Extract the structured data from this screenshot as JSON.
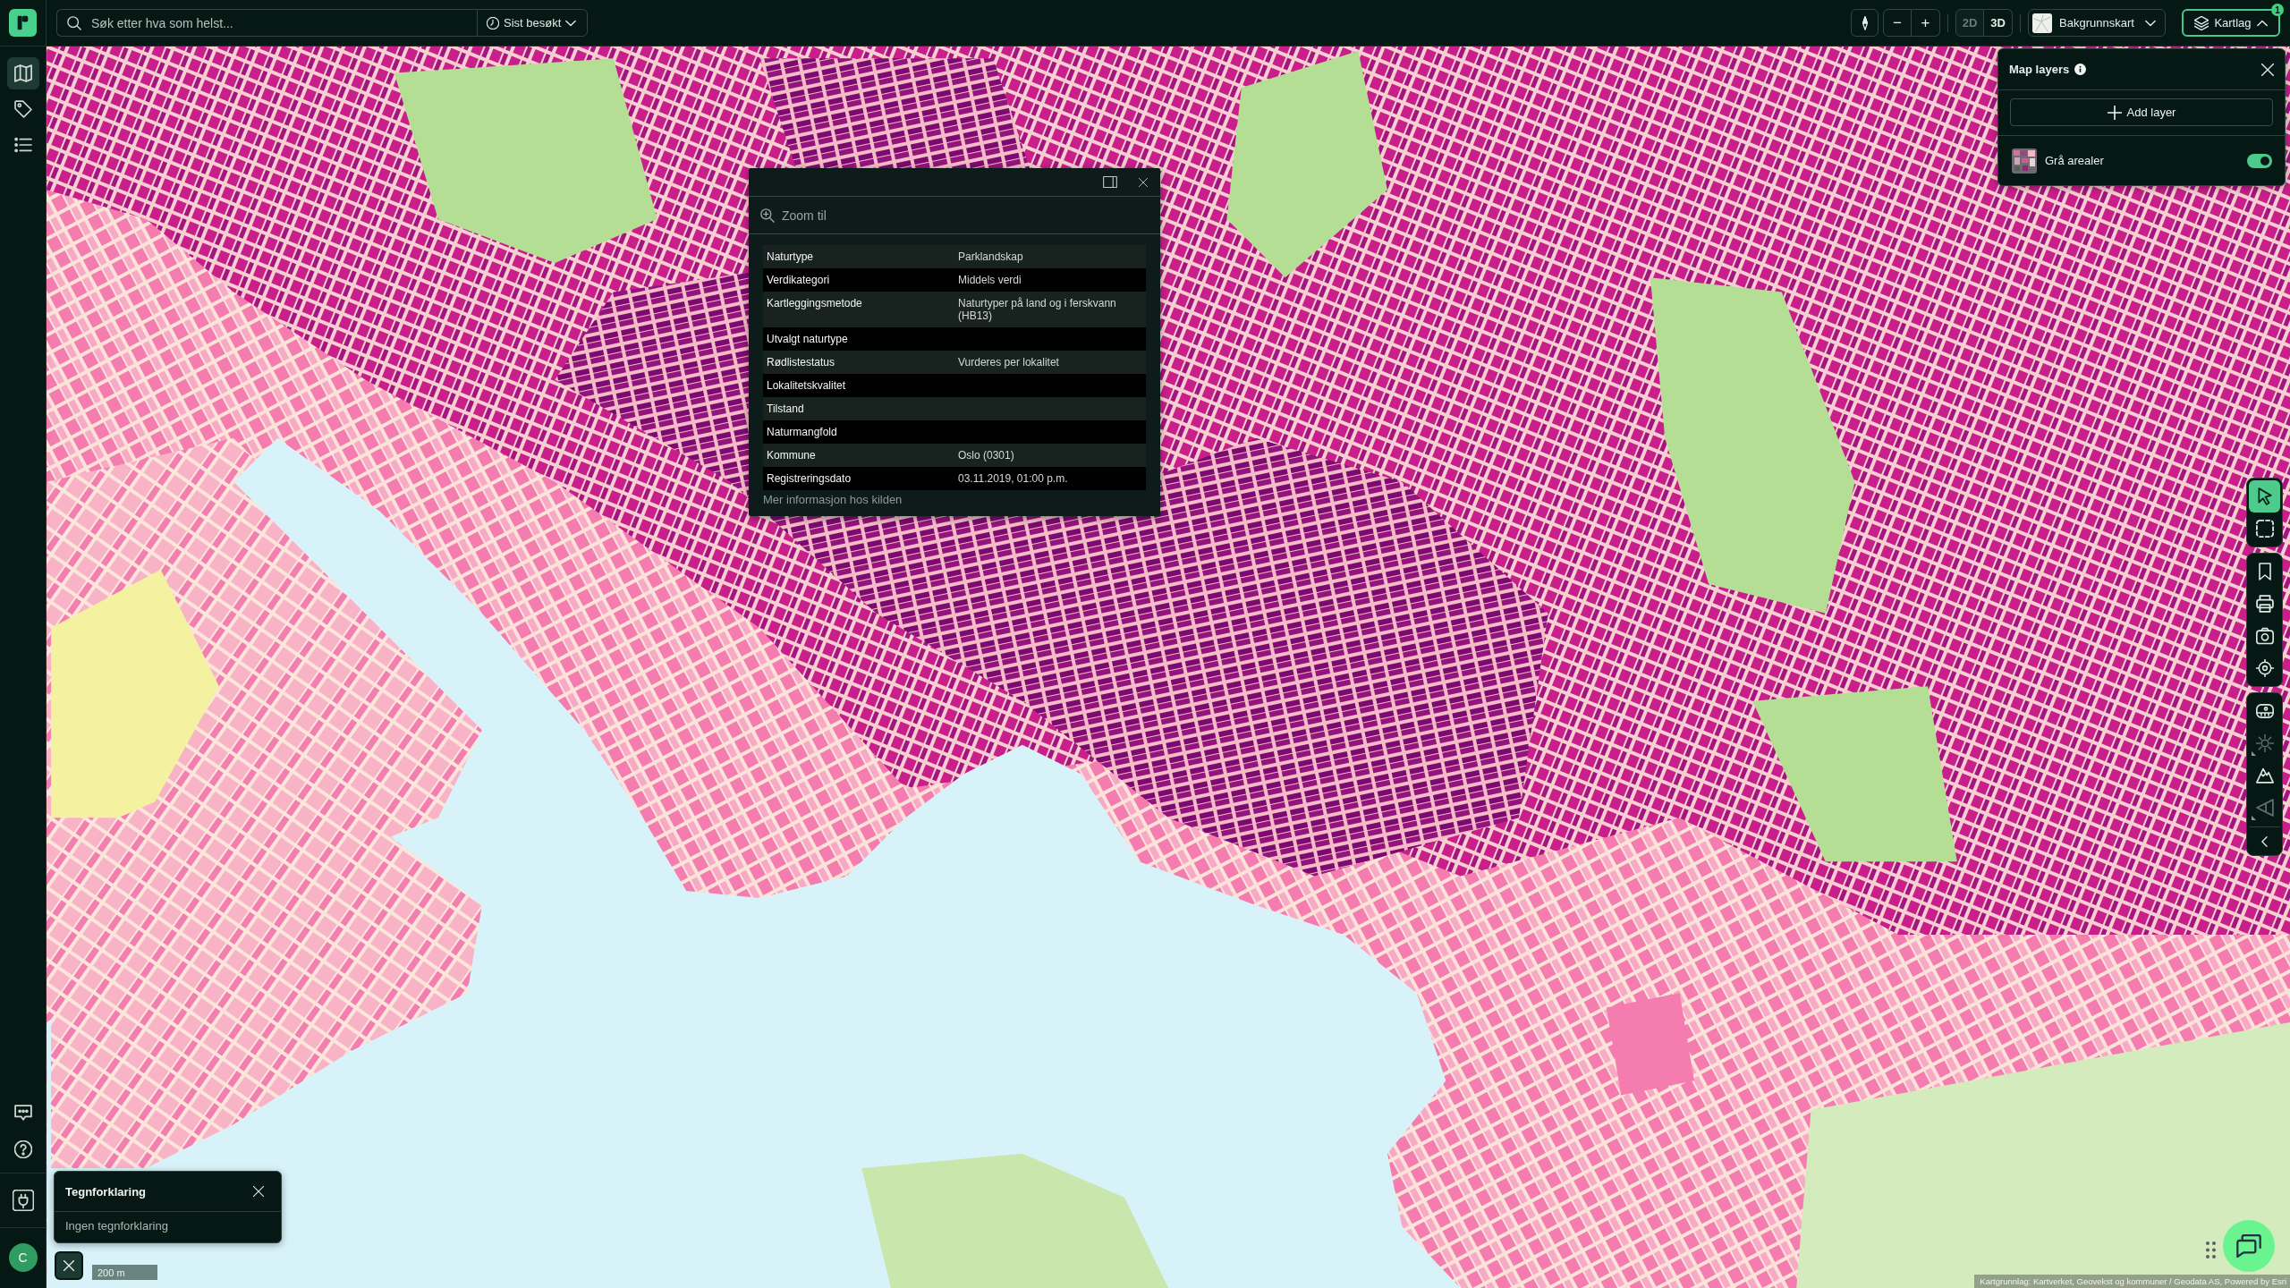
{
  "top_bar": {
    "search": {
      "placeholder": "Søk etter hva som helst..."
    },
    "recent_button": {
      "label": "Sist besøkt",
      "expanded": false
    },
    "zoom_out": "−",
    "zoom_in": "+",
    "view_modes": [
      {
        "label": "2D",
        "disabled": true
      },
      {
        "label": "3D",
        "disabled": false
      }
    ],
    "basemap_button": {
      "label": "Bakgrunnskart",
      "expanded": false
    },
    "layers_button": {
      "label": "Kartlag",
      "badge": "1",
      "expanded": true
    }
  },
  "sidebar": {
    "items": [
      {
        "kind": "map",
        "selected": true
      },
      {
        "kind": "tag",
        "selected": false
      },
      {
        "kind": "list",
        "selected": false
      }
    ],
    "bottom_items": [
      {
        "kind": "chat"
      },
      {
        "kind": "help"
      },
      {
        "kind": "legend"
      }
    ],
    "avatar": "C"
  },
  "popup": {
    "zoom_action": "Zoom til",
    "rows": [
      {
        "label": "Naturtype",
        "value": "Parklandskap"
      },
      {
        "label": "Verdikategori",
        "value": "Middels verdi"
      },
      {
        "label": "Kartleggingsmetode",
        "value": "Naturtyper på land og i ferskvann (HB13)"
      },
      {
        "label": "Utvalgt naturtype"
      },
      {
        "label": "Rødlistestatus",
        "value": "Vurderes per lokalitet"
      },
      {
        "label": "Lokalitetskvalitet"
      },
      {
        "label": "Tilstand"
      },
      {
        "label": "Naturmangfold"
      },
      {
        "label": "Kommune",
        "value": "Oslo (0301)"
      },
      {
        "label": "Registreringsdato",
        "value": "03.11.2019, 01:00 p.m."
      }
    ],
    "link": "Mer informasjon hos kilden"
  },
  "layers_panel": {
    "title": "Map layers",
    "add_button": "Add layer",
    "layers": [
      {
        "name": "Grå arealer",
        "on": true
      }
    ]
  },
  "right_toolbar": {
    "groups": [
      [
        {
          "kind": "pointer",
          "selected": true,
          "disabled": false,
          "submenu": false
        },
        {
          "kind": "marquee",
          "selected": false,
          "disabled": false,
          "submenu": false
        }
      ],
      [
        {
          "kind": "bookmark",
          "selected": false,
          "disabled": false,
          "submenu": false
        },
        {
          "kind": "print",
          "selected": false,
          "disabled": false,
          "submenu": false
        },
        {
          "kind": "camera",
          "selected": false,
          "disabled": false,
          "submenu": false
        },
        {
          "kind": "locate",
          "selected": false,
          "disabled": false,
          "submenu": false
        }
      ],
      [
        {
          "kind": "measure",
          "selected": false,
          "disabled": false,
          "submenu": false
        },
        {
          "kind": "sun",
          "selected": false,
          "disabled": true,
          "submenu": true
        },
        {
          "kind": "terrain",
          "selected": false,
          "disabled": false,
          "submenu": false
        },
        {
          "kind": "angle",
          "selected": false,
          "disabled": true,
          "submenu": true
        }
      ]
    ]
  },
  "legend_panel": {
    "title": "Tegnforklaring",
    "message": "Ingen tegnforklaring"
  },
  "scale_bar": "200 m",
  "attribution": "Kartgrunnlag: Kartverket, Geovekst og kommuner / Geodata AS, Powered by Esri"
}
